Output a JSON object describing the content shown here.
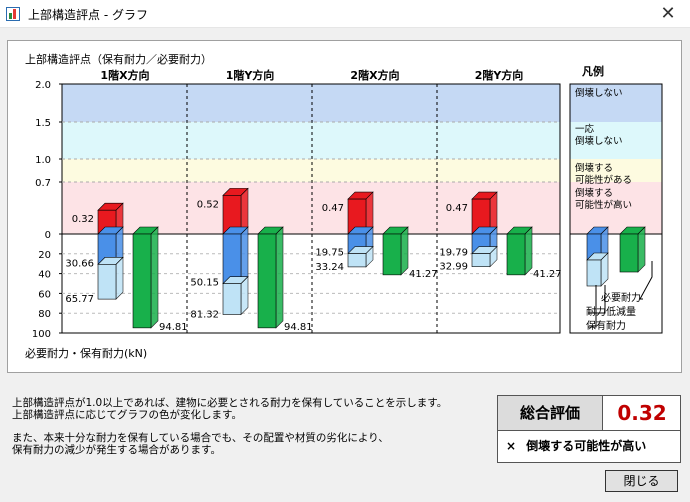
{
  "window": {
    "title": "上部構造評点 - グラフ",
    "close_symbol": "✕"
  },
  "chart_data": {
    "type": "bar",
    "title": "上部構造評点（保有耐力／必要耐力）",
    "xlabel": "",
    "ylabel_bottom": "必要耐力・保有耐力(kN)",
    "score_ticks": [
      "2.0",
      "1.5",
      "1.0",
      "0.7",
      "0"
    ],
    "force_ticks": [
      "20",
      "40",
      "60",
      "80",
      "100"
    ],
    "score_bands": [
      {
        "from": 1.5,
        "to": 2.0,
        "color": "#c5d9f4"
      },
      {
        "from": 1.0,
        "to": 1.5,
        "color": "#ddf8fb"
      },
      {
        "from": 0.7,
        "to": 1.0,
        "color": "#fdfbe0"
      },
      {
        "from": 0.0,
        "to": 0.7,
        "color": "#fde3e6"
      }
    ],
    "colors": {
      "score": "#e8191f",
      "reduction": "#4a90e8",
      "retained": "#bfe3f6",
      "required": "#18b04b"
    },
    "categories": [
      "1階X方向",
      "1階Y方向",
      "2階X方向",
      "2階Y方向"
    ],
    "series": [
      {
        "name": "上部構造評点",
        "values": [
          0.32,
          0.52,
          0.47,
          0.47
        ]
      },
      {
        "name": "保有耐力",
        "values": [
          30.66,
          50.15,
          19.75,
          19.79
        ]
      },
      {
        "name": "耐力低減量",
        "values": [
          65.77,
          81.32,
          33.24,
          32.99
        ]
      },
      {
        "name": "必要耐力",
        "values": [
          94.81,
          94.81,
          41.27,
          41.27
        ]
      }
    ],
    "legend": {
      "title": "凡例",
      "bands": [
        "倒壊しない",
        "一応\n倒壊しない",
        "倒壊する\n可能性がある",
        "倒壊する\n可能性が高い"
      ],
      "labels": [
        "必要耐力",
        "耐力低減量",
        "保有耐力"
      ]
    }
  },
  "notes": {
    "line1": "上部構造評点が1.0以上であれば、建物に必要とされる耐力を保有していることを示します。",
    "line2": "上部構造評点に応じてグラフの色が変化します。",
    "line3": "また、本来十分な耐力を保有している場合でも、その配置や材質の劣化により、",
    "line4": "保有耐力の減少が発生する場合があります。"
  },
  "evaluation": {
    "label": "総合評価",
    "score": "0.32",
    "mark": "×",
    "result": "倒壊する可能性が高い"
  },
  "buttons": {
    "close": "閉じる"
  }
}
